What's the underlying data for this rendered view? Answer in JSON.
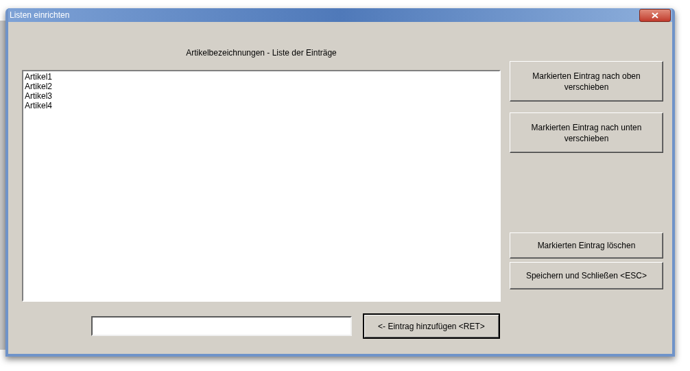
{
  "window": {
    "title": "Listen einrichten"
  },
  "list_label": "Artikelbezeichnungen - Liste der Einträge",
  "list_items": [
    {
      "text": "Artikel1",
      "selected": false
    },
    {
      "text": "Artikel2",
      "selected": false
    },
    {
      "text": "Artikel3",
      "selected": false
    },
    {
      "text": "Artikel4",
      "selected": false
    }
  ],
  "side_buttons": [
    "Markierten Eintrag nach oben verschieben",
    "Markierten Eintrag nach unten verschieben",
    "Markierten Eintrag löschen",
    "Speichern und Schließen <ESC>"
  ],
  "add_button": "<- Eintrag hinzufügen <RET>"
}
